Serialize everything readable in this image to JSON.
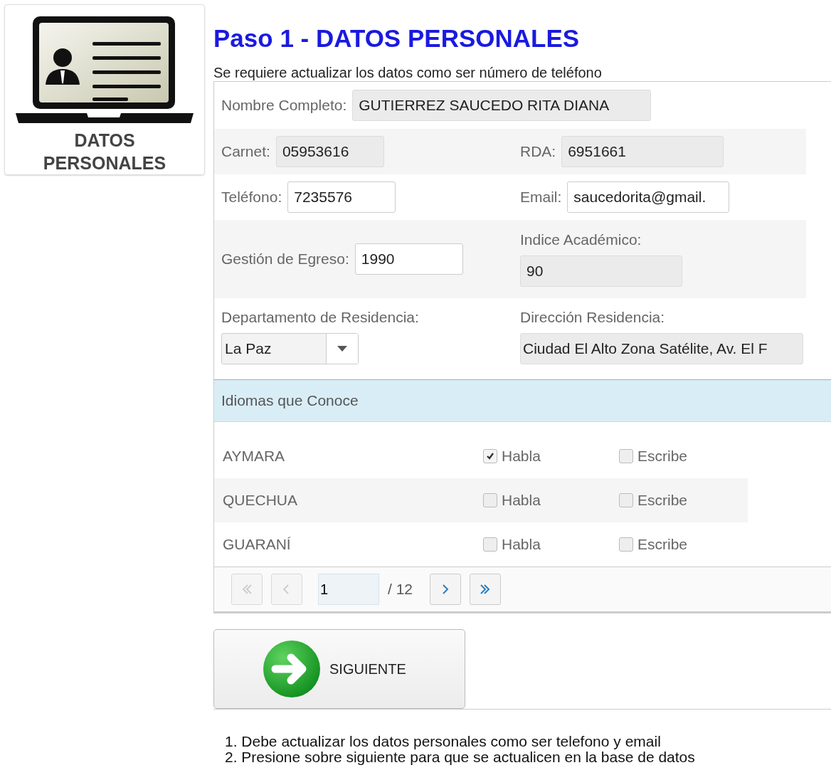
{
  "sidebar": {
    "label": "DATOS PERSONALES",
    "selected": true
  },
  "heading": "Paso 1 - DATOS PERSONALES",
  "subtitle": "Se requiere actualizar los datos como ser número de teléfono",
  "form": {
    "rows": [
      {
        "cells": [
          {
            "kind": "inline",
            "label": "Nombre Completo:",
            "value": "GUTIERREZ SAUCEDO RITA DIANA",
            "readonly": true
          }
        ]
      },
      {
        "cells": [
          {
            "kind": "inline",
            "label": "Carnet:",
            "value": "05953616",
            "readonly": true
          },
          {
            "kind": "inline",
            "label": "RDA:",
            "value": "6951661",
            "readonly": true
          }
        ]
      },
      {
        "cells": [
          {
            "kind": "inline",
            "label": "Teléfono:",
            "value": "7235576",
            "readonly": false
          },
          {
            "kind": "inline",
            "label": "Email:",
            "value": "saucedorita@gmail.",
            "readonly": false
          }
        ]
      },
      {
        "cells": [
          {
            "kind": "inline",
            "label": "Gestión de Egreso:",
            "value": "1990",
            "readonly": false
          },
          {
            "kind": "stacked",
            "label": "Indice Académico:",
            "value": "90",
            "readonly": true
          }
        ]
      },
      {
        "cells": [
          {
            "kind": "select",
            "label": "Departamento de Residencia:",
            "value": "La Paz"
          },
          {
            "kind": "stacked",
            "label": "Dirección Residencia:",
            "value": "Ciudad El Alto Zona Satélite, Av. El F",
            "readonly": true
          }
        ]
      }
    ]
  },
  "languages": {
    "header": "Idiomas que Conoce",
    "rows": [
      {
        "name": "AYMARA",
        "options": [
          {
            "label": "Habla",
            "checked": true
          },
          {
            "label": "Escribe",
            "checked": false
          }
        ]
      },
      {
        "name": "QUECHUA",
        "options": [
          {
            "label": "Habla",
            "checked": false
          },
          {
            "label": "Escribe",
            "checked": false
          }
        ]
      },
      {
        "name": "GUARANÍ",
        "options": [
          {
            "label": "Habla",
            "checked": false
          },
          {
            "label": "Escribe",
            "checked": false
          }
        ]
      }
    ],
    "pager": {
      "page": "1",
      "total": "/ 12",
      "buttons": [
        {
          "kind": "first",
          "disabled": true
        },
        {
          "kind": "prev",
          "disabled": true
        },
        {
          "kind": "next",
          "disabled": false
        },
        {
          "kind": "last",
          "disabled": false
        }
      ]
    }
  },
  "next_button": {
    "label": "SIGUIENTE"
  },
  "notes": [
    "1. Debe actualizar los datos personales como ser telefono y email",
    "2. Presione sobre siguiente para que se actualicen en la base de datos"
  ]
}
